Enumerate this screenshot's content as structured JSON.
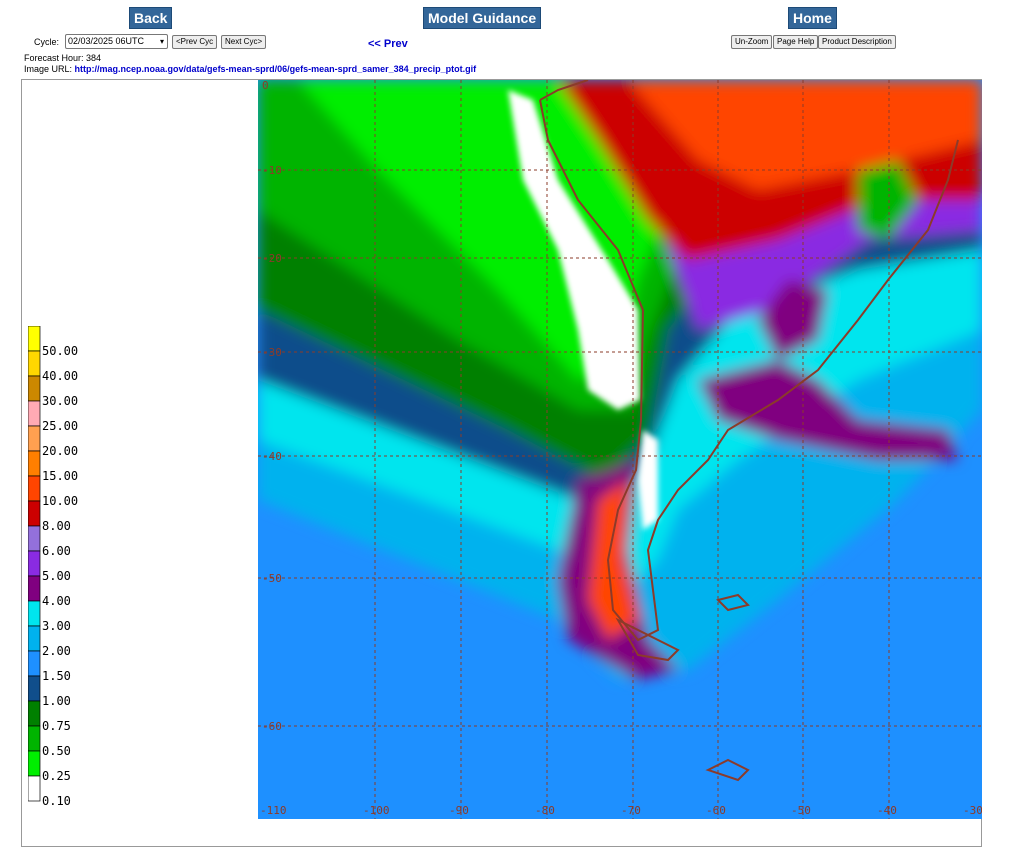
{
  "nav": {
    "back": "Back",
    "model_guidance": "Model Guidance",
    "home": "Home"
  },
  "cycle": {
    "label": "Cycle:",
    "value": "02/03/2025 06UTC",
    "prev": "<Prev Cyc",
    "next": "Next Cyc>"
  },
  "prev_link": "<< Prev",
  "tools": {
    "unzoom": "Un-Zoom",
    "help": "Page Help",
    "desc": "Product Description"
  },
  "forecast_hour": "Forecast Hour: 384",
  "image_url": {
    "label": "Image URL:",
    "url": "http://mag.ncep.noaa.gov/data/gefs-mean-sprd/06/gefs-mean-sprd_samer_384_precip_ptot.gif"
  },
  "legend": [
    {
      "label": "50.00",
      "color": "#ffff00"
    },
    {
      "label": "40.00",
      "color": "#ffd700"
    },
    {
      "label": "30.00",
      "color": "#cc8800"
    },
    {
      "label": "25.00",
      "color": "#ffaab4"
    },
    {
      "label": "20.00",
      "color": "#ffa050"
    },
    {
      "label": "15.00",
      "color": "#ff7f00"
    },
    {
      "label": "10.00",
      "color": "#ff4500"
    },
    {
      "label": "8.00",
      "color": "#cc0000"
    },
    {
      "label": "6.00",
      "color": "#9370db"
    },
    {
      "label": "5.00",
      "color": "#8a2be2"
    },
    {
      "label": "4.00",
      "color": "#800080"
    },
    {
      "label": "3.00",
      "color": "#00e5ee"
    },
    {
      "label": "2.00",
      "color": "#00b2ee"
    },
    {
      "label": "1.50",
      "color": "#1e90ff"
    },
    {
      "label": "1.00",
      "color": "#104e8b"
    },
    {
      "label": "0.75",
      "color": "#008000"
    },
    {
      "label": "0.50",
      "color": "#00b400"
    },
    {
      "label": "0.25",
      "color": "#00ee00"
    },
    {
      "label": "0.10",
      "color": "#ffffff"
    }
  ],
  "lon_labels": [
    "-110",
    "-100",
    "-90",
    "-80",
    "-70",
    "-60",
    "-50",
    "-40",
    "-30"
  ],
  "lat_labels": [
    "0",
    "-10",
    "-20",
    "-30",
    "-40",
    "-50",
    "-60"
  ]
}
